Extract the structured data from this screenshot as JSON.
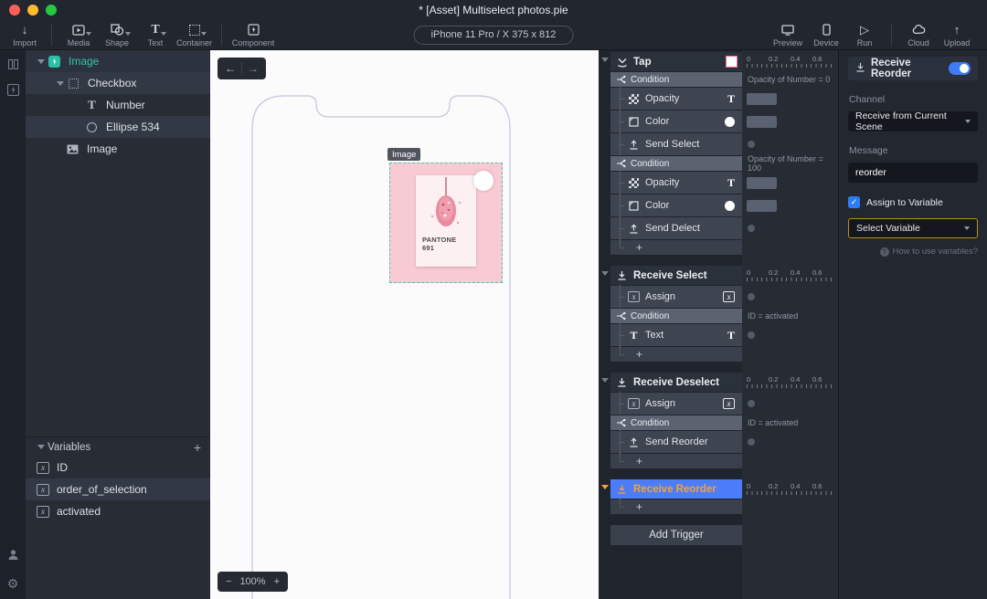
{
  "titlebar": {
    "title": "* [Asset] Multiselect photos.pie"
  },
  "toolbar": {
    "items_left": [
      {
        "label": "Import"
      },
      {
        "label": "Media"
      },
      {
        "label": "Shape"
      },
      {
        "label": "Text"
      },
      {
        "label": "Container"
      },
      {
        "label": "Component"
      }
    ],
    "device": "iPhone 11 Pro / X  375 x 812",
    "items_right": [
      {
        "label": "Preview"
      },
      {
        "label": "Device"
      },
      {
        "label": "Run"
      },
      {
        "label": "Cloud"
      },
      {
        "label": "Upload"
      }
    ]
  },
  "layers": {
    "tree": [
      {
        "label": "Image"
      },
      {
        "label": "Checkbox"
      },
      {
        "label": "Number"
      },
      {
        "label": "Ellipse 534"
      },
      {
        "label": "Image"
      }
    ],
    "variables_title": "Variables",
    "variables": [
      {
        "name": "ID"
      },
      {
        "name": "order_of_selection"
      },
      {
        "name": "activated"
      }
    ]
  },
  "canvas": {
    "selection_label": "Image",
    "card_line1": "PANTONE",
    "card_line2": "691",
    "zoom_value": "100%"
  },
  "ruler": {
    "t0": "0",
    "t1": "0.2",
    "t2": "0.4",
    "t3": "0.6"
  },
  "triggers": {
    "sections": [
      {
        "title": "Tap",
        "rows": [
          {
            "label": "Condition",
            "note": "Opacity of Number = 0"
          },
          {
            "label": "Opacity"
          },
          {
            "label": "Color"
          },
          {
            "label": "Send Select"
          },
          {
            "label": "Condition",
            "note": "Opacity of Number = 100"
          },
          {
            "label": "Opacity"
          },
          {
            "label": "Color"
          },
          {
            "label": "Send Delect"
          }
        ]
      },
      {
        "title": "Receive Select",
        "rows": [
          {
            "label": "Assign"
          },
          {
            "label": "Condition",
            "note": "ID = activated"
          },
          {
            "label": "Text"
          }
        ]
      },
      {
        "title": "Receive Deselect",
        "rows": [
          {
            "label": "Assign"
          },
          {
            "label": "Condition",
            "note": "ID = activated"
          },
          {
            "label": "Send Reorder"
          }
        ]
      },
      {
        "title": "Receive Reorder",
        "rows": []
      }
    ],
    "add_trigger": "Add Trigger"
  },
  "properties": {
    "title": "Receive Reorder",
    "channel_label": "Channel",
    "channel_value": "Receive from Current Scene",
    "message_label": "Message",
    "message_value": "reorder",
    "assign_label": "Assign to Variable",
    "variable_value": "Select Variable",
    "help": "How to use variables?"
  },
  "misc": {
    "plus": "+",
    "minus": "−",
    "back": "←",
    "forward": "→",
    "question": "?",
    "check": "✓"
  },
  "colors": {
    "accent_blue": "#4c7cf7",
    "accent_orange": "#f2a33c",
    "accent_teal": "#2dbfa5",
    "tap_chip_border": "#f06a98"
  }
}
